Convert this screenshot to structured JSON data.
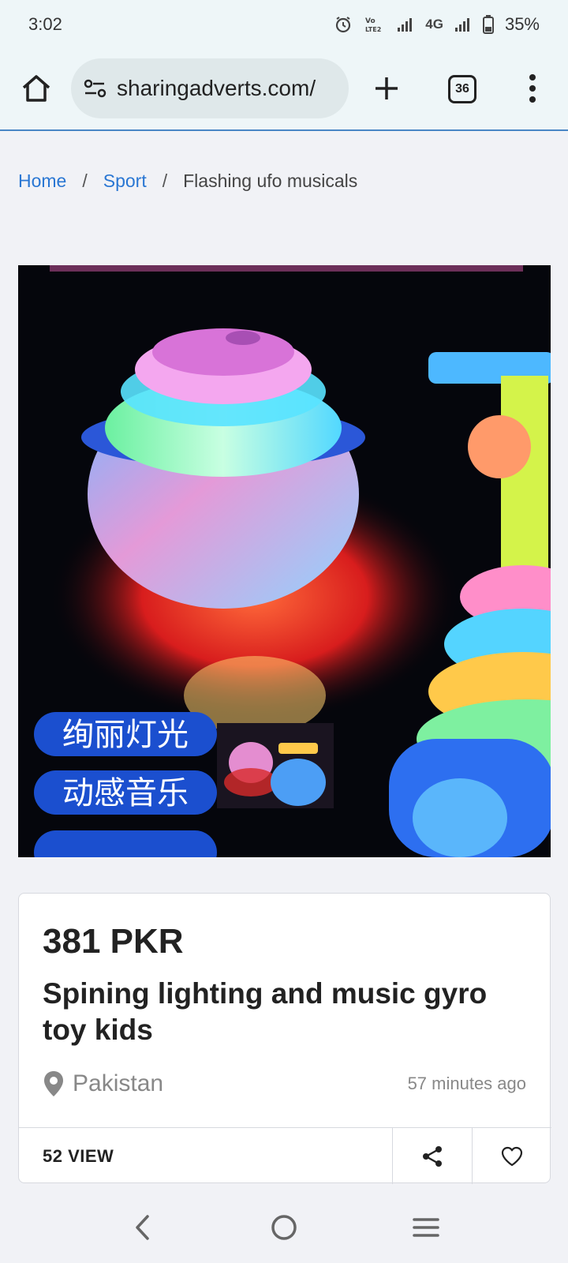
{
  "status_bar": {
    "time": "3:02",
    "network_label": "4G",
    "battery_percent": "35%",
    "icons": [
      "alarm-icon",
      "volte-icon",
      "signal-icon",
      "signal-icon",
      "battery-icon"
    ]
  },
  "browser": {
    "url": "sharingadverts.com/",
    "tab_count": "36",
    "icons": [
      "home-icon",
      "site-settings-icon",
      "plus-icon",
      "more-vert-icon"
    ]
  },
  "breadcrumb": {
    "items": [
      {
        "label": "Home",
        "link": true
      },
      {
        "label": "Sport",
        "link": true
      },
      {
        "label": "Flashing ufo musicals",
        "link": false
      }
    ],
    "separator": "/"
  },
  "product": {
    "image_text_lines": [
      "绚丽灯光",
      "动感音乐"
    ],
    "price": "381 PKR",
    "title": "Spining lighting and music gyro toy kids",
    "location": "Pakistan",
    "posted": "57 minutes ago",
    "views": "52 VIEW"
  },
  "colors": {
    "link": "#2a77d3",
    "browser_bar": "#eef6f8",
    "page_bg": "#f1f2f6",
    "accent_line": "#4a86c5"
  }
}
